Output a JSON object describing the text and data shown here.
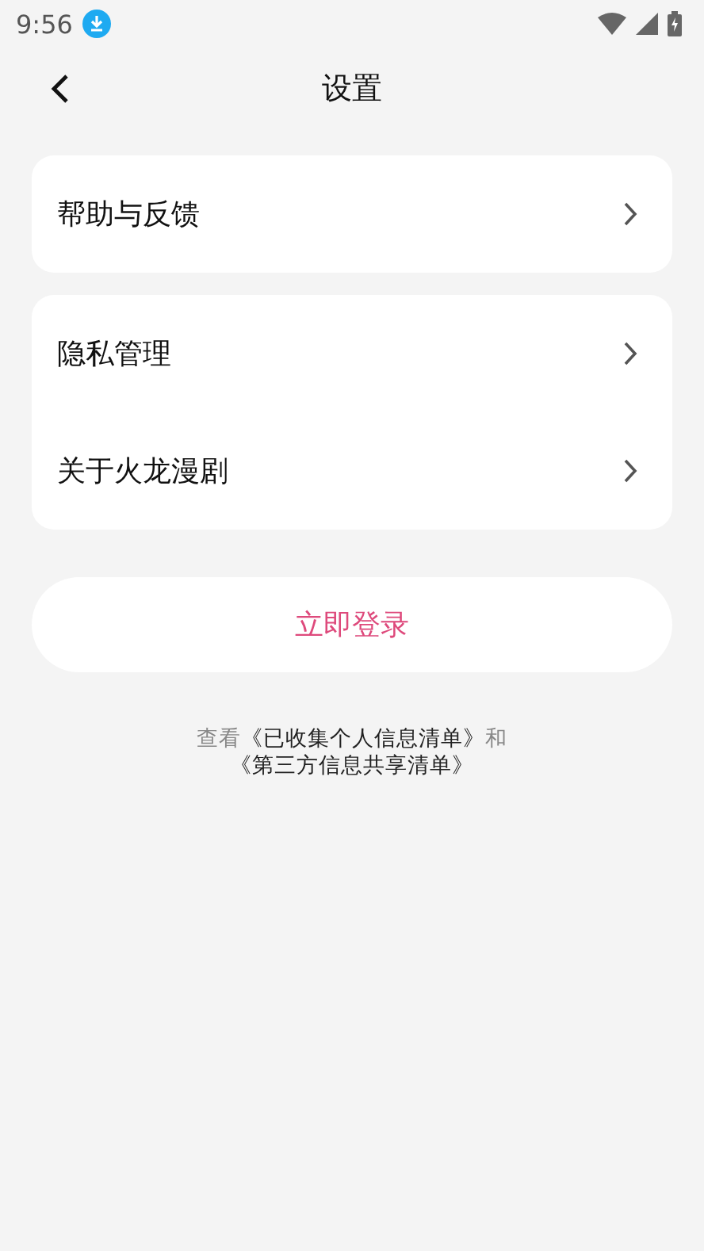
{
  "status_bar": {
    "time": "9:56"
  },
  "header": {
    "title": "设置"
  },
  "groups": [
    {
      "items": [
        {
          "label": "帮助与反馈"
        }
      ]
    },
    {
      "items": [
        {
          "label": "隐私管理"
        },
        {
          "label": "关于火龙漫剧"
        }
      ]
    }
  ],
  "login_button": {
    "label": "立即登录"
  },
  "notice": [
    {
      "kind": "text",
      "text": "查看"
    },
    {
      "kind": "link",
      "text": "《已收集个人信息清单》"
    },
    {
      "kind": "text",
      "text": "和"
    },
    {
      "kind": "link",
      "text": "《第三方信息共享清单》"
    }
  ]
}
